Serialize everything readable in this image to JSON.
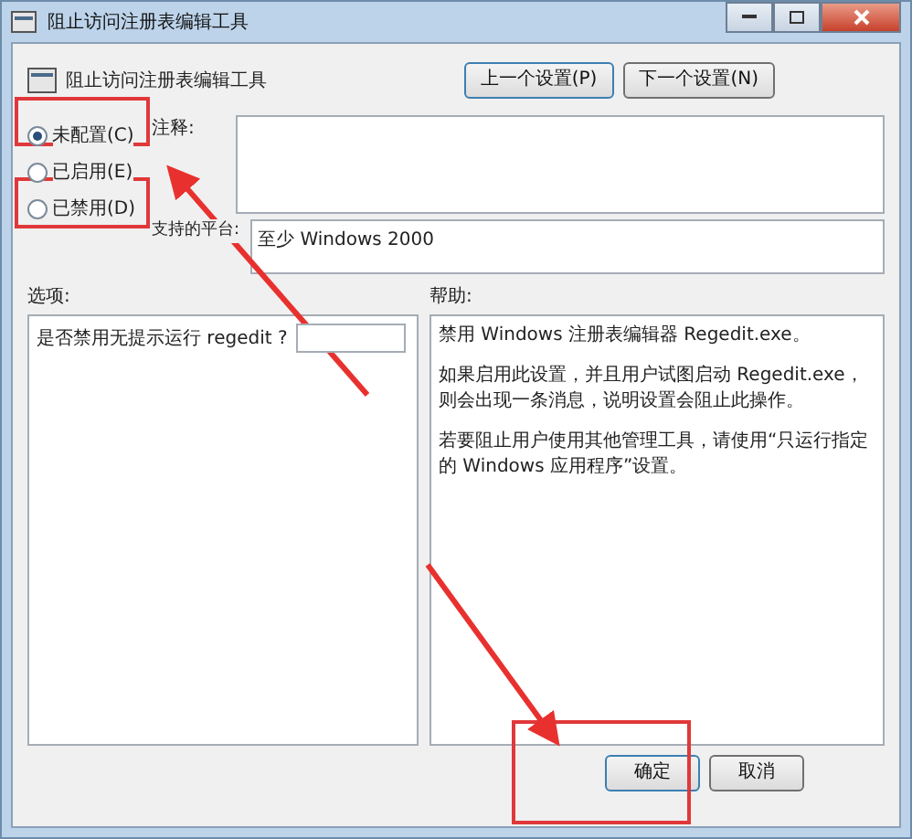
{
  "window": {
    "title": "阻止访问注册表编辑工具"
  },
  "header": {
    "title": "阻止访问注册表编辑工具",
    "buttons": [
      "上一个设置(P)",
      "下一个设置(N)"
    ]
  },
  "radios": [
    {
      "label": "未配置(C)",
      "selected": true
    },
    {
      "label": "已启用(E)",
      "selected": false
    },
    {
      "label": "已禁用(D)",
      "selected": false
    }
  ],
  "comment": {
    "label": "注释:"
  },
  "platform": {
    "label": "支持的平台:",
    "value": "至少 Windows 2000"
  },
  "options": {
    "label": "选项:",
    "question": "是否禁用无提示运行 regedit ?"
  },
  "help": {
    "label": "帮助:",
    "paragraphs": [
      "禁用 Windows 注册表编辑器 Regedit.exe。",
      "如果启用此设置，并且用户试图启动 Regedit.exe，则会出现一条消息，说明设置会阻止此操作。",
      "若要阻止用户使用其他管理工具，请使用“只运行指定的 Windows 应用程序”设置。"
    ]
  },
  "footer": {
    "buttons": [
      "确定",
      "取消"
    ]
  }
}
